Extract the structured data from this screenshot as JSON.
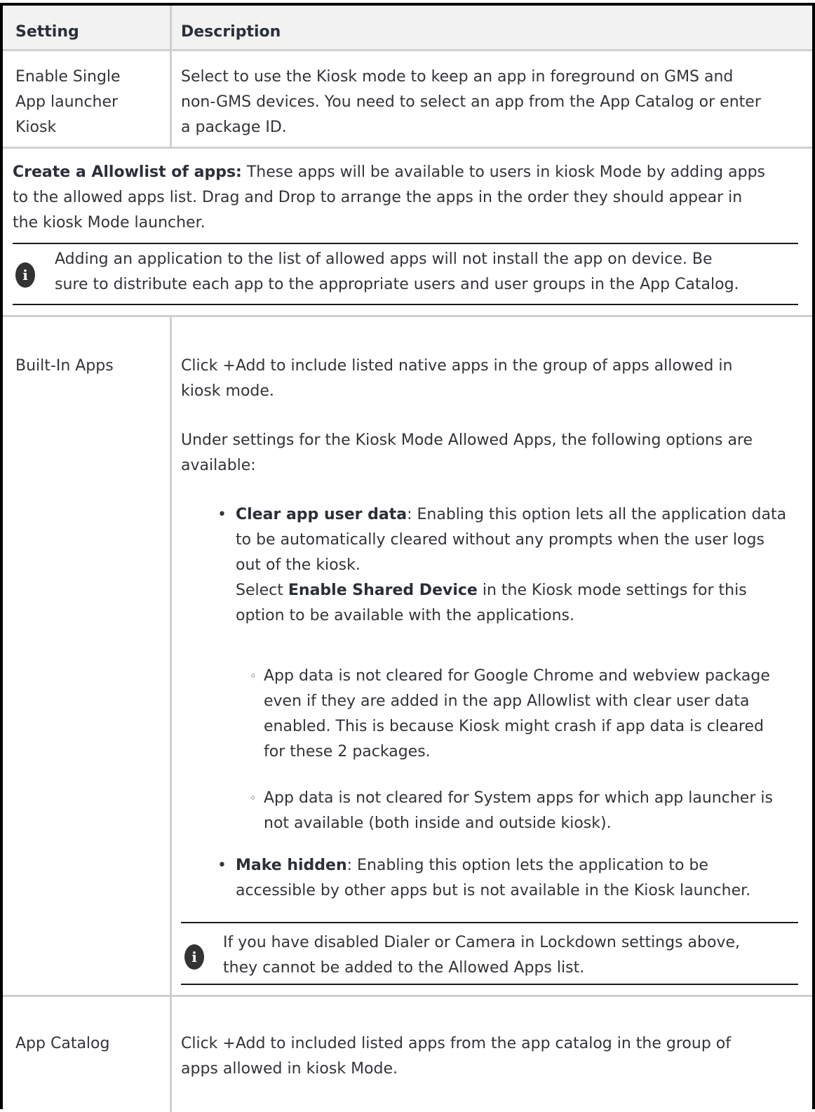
{
  "header": {
    "setting": "Setting",
    "description": "Description"
  },
  "rows": [
    {
      "setting": [
        "Enable Single",
        "App launcher",
        "Kiosk"
      ],
      "description": [
        "Select to use the Kiosk mode to keep an app in foreground on GMS and",
        "non-GMS devices. You need to select an app from the App Catalog or enter",
        "a package ID."
      ]
    }
  ],
  "allowlist": {
    "title": "Create a Allowlist of apps:",
    "text_line1": " These apps will be available to users in kiosk Mode by adding apps",
    "text_line2": "to the allowed apps list. Drag and Drop to arrange the apps in the order they should appear in",
    "text_line3": "the kiosk Mode launcher.",
    "note_line1": "Adding an application to the list of allowed apps will not install the app on device. Be",
    "note_line2": "sure to distribute each app to the appropriate users and user groups in the App Catalog."
  },
  "built_in": {
    "setting": "Built-In Apps",
    "p1_line1": "Click +Add to include listed native apps in the group of apps allowed in",
    "p1_line2": "kiosk mode.",
    "p2_line1": "Under settings for the Kiosk Mode Allowed Apps, the following options are",
    "p2_line2": "available:",
    "clear_title": "Clear app user data",
    "clear_line1": ": Enabling this option lets all the application data",
    "clear_line2": "to be automatically cleared without any prompts when the user logs",
    "clear_line3": "out of the kiosk.",
    "clear_line4_pre": "Select ",
    "clear_line4_bold": "Enable Shared Device",
    "clear_line4_post": " in the Kiosk mode settings for this",
    "clear_line5": "option to be available with the applications.",
    "sub1_line1": "App data is not cleared for Google Chrome and webview package",
    "sub1_line2": "even if they are added in the app Allowlist with clear user data",
    "sub1_line3": "enabled. This is because Kiosk might crash if app data is cleared",
    "sub1_line4": "for these 2 packages.",
    "sub2_line1": "App data is not cleared for System apps for which app launcher is",
    "sub2_line2": "not available (both inside and outside kiosk).",
    "hidden_title": "Make hidden",
    "hidden_line1": ": Enabling this option lets the application to be",
    "hidden_line2": "accessible by other apps but is not available in the Kiosk launcher.",
    "note_line1": "If you have disabled Dialer or Camera in Lockdown settings above,",
    "note_line2": "they cannot be added to the Allowed Apps list."
  },
  "app_catalog": {
    "setting": "App Catalog",
    "line1": "Click +Add to included listed apps from the app catalog in the group of",
    "line2": "apps allowed in kiosk Mode."
  },
  "icons": {
    "note_icon": "info-icon",
    "bullet": "•",
    "sub_bullet": "◦"
  }
}
